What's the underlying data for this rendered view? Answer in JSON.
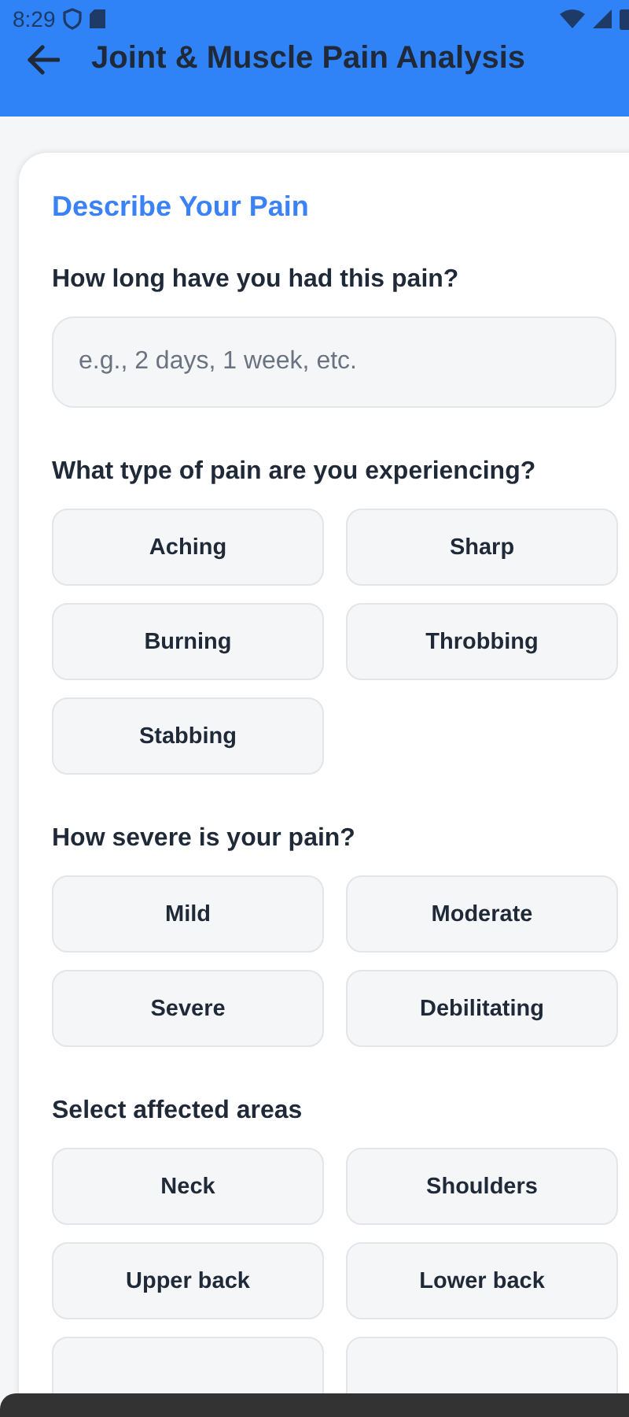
{
  "status_bar": {
    "time": "8:29"
  },
  "app_bar": {
    "title": "Joint & Muscle Pain Analysis"
  },
  "card": {
    "title": "Describe Your Pain"
  },
  "duration": {
    "question": "How long have you had this pain?",
    "placeholder": "e.g., 2 days, 1 week, etc."
  },
  "pain_type": {
    "question": "What type of pain are you experiencing?",
    "options": [
      {
        "label": "Aching",
        "selected": false
      },
      {
        "label": "Sharp",
        "selected": false
      },
      {
        "label": "Burning",
        "selected": false
      },
      {
        "label": "Throbbing",
        "selected": false
      },
      {
        "label": "Stabbing",
        "selected": false
      }
    ]
  },
  "severity": {
    "question": "How severe is your pain?",
    "options": [
      {
        "label": "Mild",
        "selected": false
      },
      {
        "label": "Moderate",
        "selected": false
      },
      {
        "label": "Severe",
        "selected": false
      },
      {
        "label": "Debilitating",
        "selected": false
      }
    ]
  },
  "areas": {
    "question": "Select affected areas",
    "options": [
      {
        "label": "Neck",
        "selected": false
      },
      {
        "label": "Shoulders",
        "selected": false
      },
      {
        "label": "Upper back",
        "selected": false
      },
      {
        "label": "Lower back",
        "selected": false
      },
      {
        "selected": false
      },
      {
        "selected": false
      }
    ]
  }
}
